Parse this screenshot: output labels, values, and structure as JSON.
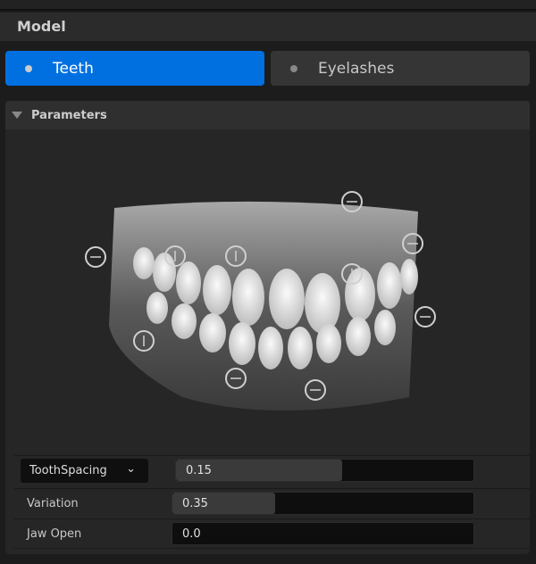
{
  "header": {
    "title": "Model"
  },
  "tabs": [
    {
      "label": "Teeth",
      "active": true
    },
    {
      "label": "Eyelashes",
      "active": false
    }
  ],
  "colors": {
    "accent": "#0070e0"
  },
  "panel": {
    "title": "Parameters"
  },
  "params": {
    "dropdown": {
      "selected": "ToothSpacing",
      "value": "0.15",
      "fill": 0.56
    },
    "variation": {
      "label": "Variation",
      "value": "0.35",
      "fill": 0.34
    },
    "jaw_open": {
      "label": "Jaw Open",
      "value": "0.0",
      "fill": 0
    }
  }
}
